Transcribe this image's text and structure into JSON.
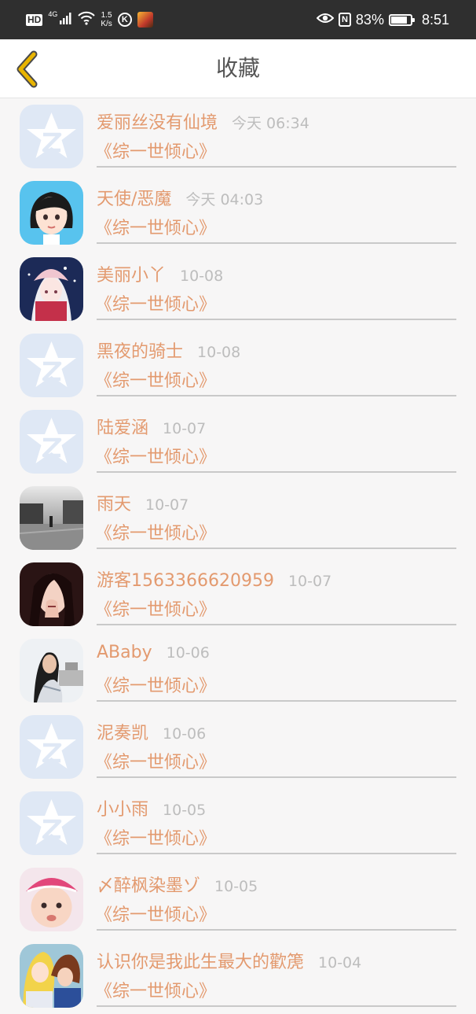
{
  "statusbar": {
    "hd": "HD",
    "network": "4G",
    "speed_value": "1.5",
    "speed_unit": "K/s",
    "k_icon": "K",
    "nfc": "N",
    "battery": "83%",
    "battery_level": 0.83,
    "time": "8:51"
  },
  "header": {
    "title": "收藏",
    "back_icon": "chevron-left-icon",
    "accent": "#e8b400"
  },
  "colors": {
    "name": "#e39a6f",
    "time": "#bdbdbd",
    "background": "#f7f6f6"
  },
  "items": [
    {
      "name": "爱丽丝没有仙境",
      "time": "今天 06:34",
      "book": "《综一世倾心》",
      "avatar": "default-star-avatar"
    },
    {
      "name": "天使/恶魔",
      "time": "今天 04:03",
      "book": "《综一世倾心》",
      "avatar": "cartoon-girl-avatar"
    },
    {
      "name": "美丽小丫",
      "time": "10-08",
      "book": "《综一世倾心》",
      "avatar": "anime-girl-avatar"
    },
    {
      "name": "黑夜的骑士",
      "time": "10-08",
      "book": "《综一世倾心》",
      "avatar": "default-star-avatar"
    },
    {
      "name": "陆爱涵",
      "time": "10-07",
      "book": "《综一世倾心》",
      "avatar": "default-star-avatar"
    },
    {
      "name": "雨天",
      "time": "10-07",
      "book": "《综一世倾心》",
      "avatar": "rainy-street-avatar"
    },
    {
      "name": "游客1563366620959",
      "time": "10-07",
      "book": "《综一世倾心》",
      "avatar": "dark-portrait-avatar"
    },
    {
      "name": "ABaby",
      "time": "10-06",
      "book": "《综一世倾心》",
      "avatar": "woman-photo-avatar"
    },
    {
      "name": "泥奏凯",
      "time": "10-06",
      "book": "《综一世倾心》",
      "avatar": "default-star-avatar"
    },
    {
      "name": "小小雨",
      "time": "10-05",
      "book": "《综一世倾心》",
      "avatar": "default-star-avatar"
    },
    {
      "name": "〆醉枫染墨ゾ",
      "time": "10-05",
      "book": "《综一世倾心》",
      "avatar": "baby-photo-avatar"
    },
    {
      "name": "认识你是我此生最大的歡箎",
      "time": "10-04",
      "book": "《综一世倾心》",
      "avatar": "anime-couple-avatar"
    }
  ]
}
